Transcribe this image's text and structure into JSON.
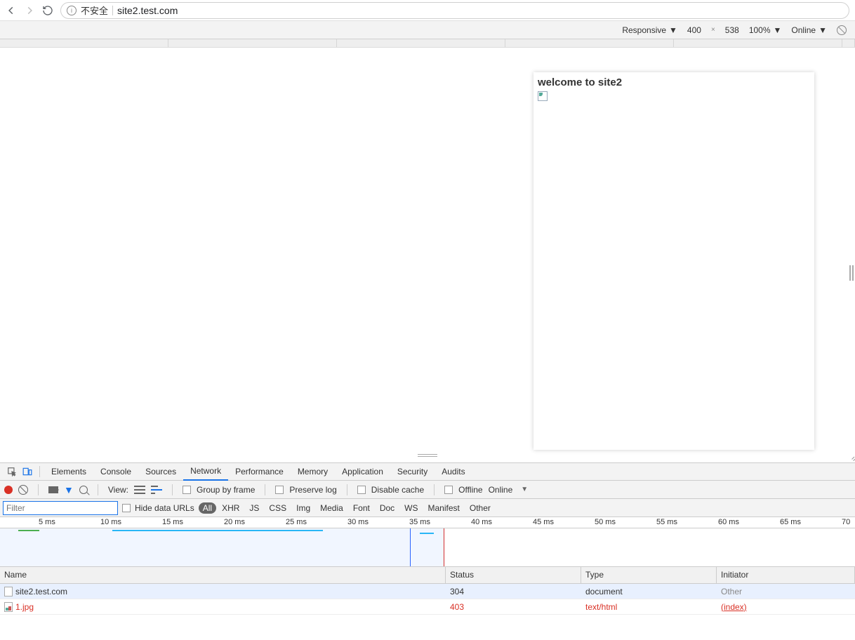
{
  "browser": {
    "security_label": "不安全",
    "url": "site2.test.com"
  },
  "device_bar": {
    "mode": "Responsive",
    "width": "400",
    "height": "538",
    "zoom": "100%",
    "throttle": "Online"
  },
  "page": {
    "heading": "welcome to site2"
  },
  "devtools_tabs": [
    "Elements",
    "Console",
    "Sources",
    "Network",
    "Performance",
    "Memory",
    "Application",
    "Security",
    "Audits"
  ],
  "devtools_active_tab": "Network",
  "net_toolbar": {
    "view_label": "View:",
    "group_by_frame": "Group by frame",
    "preserve_log": "Preserve log",
    "disable_cache": "Disable cache",
    "offline": "Offline",
    "online": "Online"
  },
  "filter": {
    "placeholder": "Filter",
    "hide_data_urls": "Hide data URLs",
    "types": [
      "All",
      "XHR",
      "JS",
      "CSS",
      "Img",
      "Media",
      "Font",
      "Doc",
      "WS",
      "Manifest",
      "Other"
    ],
    "active": "All"
  },
  "timeline_ticks": [
    "5 ms",
    "10 ms",
    "15 ms",
    "20 ms",
    "25 ms",
    "30 ms",
    "35 ms",
    "40 ms",
    "45 ms",
    "50 ms",
    "55 ms",
    "60 ms",
    "65 ms",
    "70"
  ],
  "table": {
    "headers": {
      "name": "Name",
      "status": "Status",
      "type": "Type",
      "initiator": "Initiator"
    },
    "rows": [
      {
        "name": "site2.test.com",
        "status": "304",
        "type": "document",
        "initiator": "Other",
        "error": false,
        "selected": true,
        "icon": "doc"
      },
      {
        "name": "1.jpg",
        "status": "403",
        "type": "text/html",
        "initiator": "(index)",
        "error": true,
        "selected": false,
        "icon": "img",
        "initiator_link": true
      }
    ]
  }
}
